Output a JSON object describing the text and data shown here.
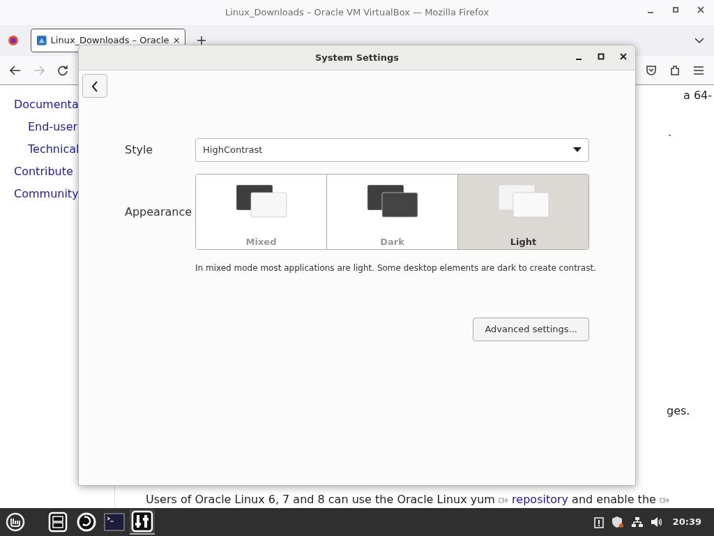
{
  "browser": {
    "window_title": "Linux_Downloads – Oracle VM VirtualBox — Mozilla Firefox",
    "tab": {
      "title": "Linux_Downloads – Oracle",
      "selected": true
    },
    "forward_disabled": true
  },
  "page": {
    "sidebar": [
      {
        "label": "Documenta",
        "children": [
          {
            "label": "End-user"
          },
          {
            "label": "Technical"
          }
        ]
      },
      {
        "label": "Contribute"
      },
      {
        "label": "Community"
      }
    ],
    "fragments": [
      {
        "text": "a 64-",
        "kind": "text"
      },
      {
        "text": ".",
        "kind": "link"
      },
      {
        "text": "ges.",
        "kind": "text"
      }
    ],
    "paragraph": {
      "before": "Users of Oracle Linux 6, 7 and 8 can use the Oracle Linux yum",
      "link": "repository",
      "after": "and enable the"
    }
  },
  "dialog": {
    "title": "System Settings",
    "style": {
      "label": "Style",
      "value": "HighContrast"
    },
    "appearance": {
      "label": "Appearance",
      "options": [
        {
          "label": "Mixed",
          "kind": "mixed",
          "selected": false
        },
        {
          "label": "Dark",
          "kind": "dark",
          "selected": false
        },
        {
          "label": "Light",
          "kind": "light",
          "selected": true
        }
      ]
    },
    "description": "In mixed mode most applications are light. Some desktop elements are dark to create contrast.",
    "advanced_button": "Advanced settings..."
  },
  "taskbar": {
    "apps": [
      {
        "kind": "files",
        "active": false
      },
      {
        "kind": "firefox",
        "active": false
      },
      {
        "kind": "terminal",
        "active": false
      },
      {
        "kind": "settings",
        "active": true
      }
    ],
    "clock": "20:39"
  }
}
